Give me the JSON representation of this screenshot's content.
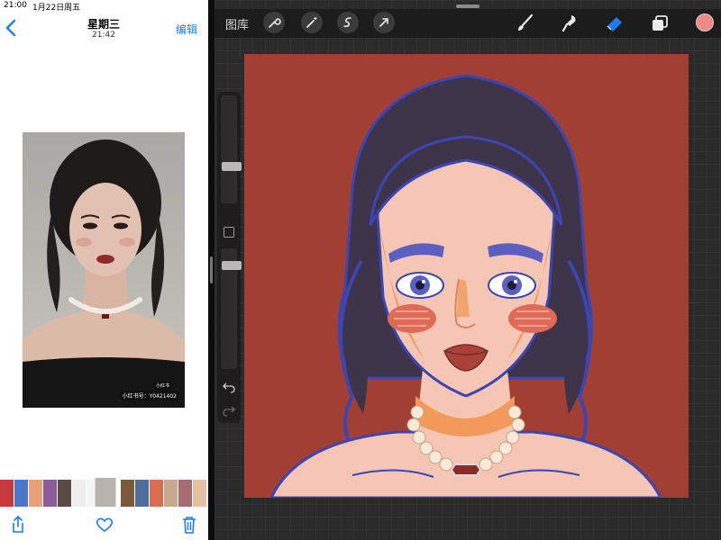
{
  "status": {
    "time": "21:00",
    "date": "1月22日周五"
  },
  "photos": {
    "nav": {
      "title": "星期三",
      "subtitle": "21:42",
      "edit_label": "编辑"
    },
    "watermark": {
      "id_text": "小红书号：Y0421402",
      "badge": "小红书"
    }
  },
  "procreate": {
    "gallery_label": "图库",
    "colors": {
      "canvas": "#a23f33",
      "active_color": "#f08a84",
      "eraser_active": "#1a7cf5"
    },
    "tools": [
      "wrench-icon",
      "magic-wand-icon",
      "selection-icon",
      "transform-icon",
      "brush-icon",
      "smudge-icon",
      "eraser-icon",
      "layers-icon"
    ]
  }
}
